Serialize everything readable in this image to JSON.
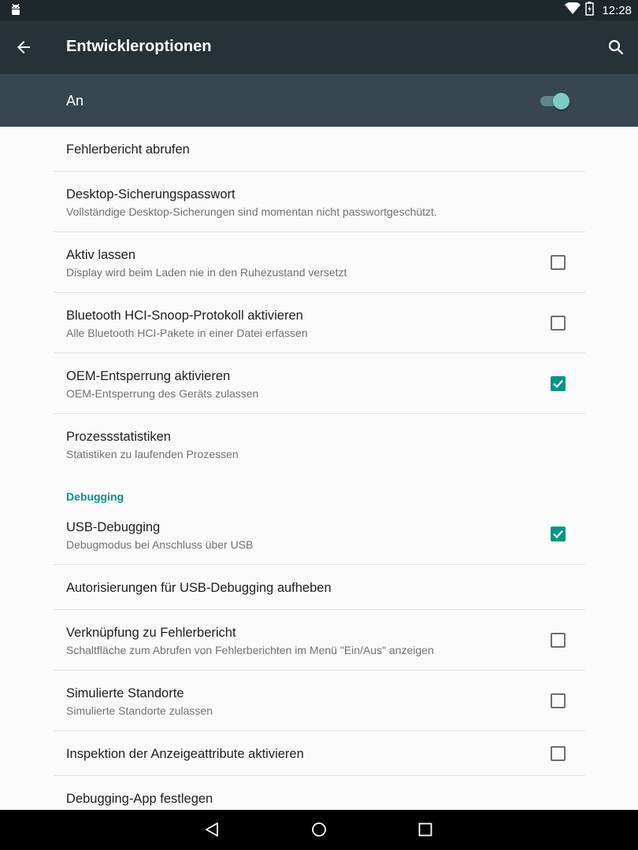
{
  "status_bar": {
    "time": "12:28",
    "icons": [
      "android-icon",
      "wifi-icon",
      "battery-icon"
    ]
  },
  "toolbar": {
    "title": "Entwickleroptionen",
    "back_icon": "arrow-back-icon",
    "search_icon": "search-icon"
  },
  "master_switch": {
    "label": "An",
    "checked": true
  },
  "items": [
    {
      "title": "Fehlerbericht abrufen",
      "summary": "",
      "checkbox": null
    },
    {
      "title": "Desktop-Sicherungspasswort",
      "summary": "Vollständige Desktop-Sicherungen sind momentan nicht passwortgeschützt.",
      "checkbox": null
    },
    {
      "title": "Aktiv lassen",
      "summary": "Display wird beim Laden nie in den Ruhezustand versetzt",
      "checkbox": false
    },
    {
      "title": "Bluetooth HCI-Snoop-Protokoll aktivieren",
      "summary": "Alle Bluetooth HCI-Pakete in einer Datei erfassen",
      "checkbox": false
    },
    {
      "title": "OEM-Entsperrung aktivieren",
      "summary": "OEM-Entsperrung des Geräts zulassen",
      "checkbox": true
    },
    {
      "title": "Prozessstatistiken",
      "summary": "Statistiken zu laufenden Prozessen",
      "checkbox": null
    }
  ],
  "debugging": {
    "category": "Debugging",
    "items": [
      {
        "title": "USB-Debugging",
        "summary": "Debugmodus bei Anschluss über USB",
        "checkbox": true
      },
      {
        "title": "Autorisierungen für USB-Debugging aufheben",
        "summary": "",
        "checkbox": null
      },
      {
        "title": "Verknüpfung zu Fehlerbericht",
        "summary": "Schaltfläche zum Abrufen von Fehlerberichten im Menü \"Ein/Aus\" anzeigen",
        "checkbox": false
      },
      {
        "title": "Simulierte Standorte",
        "summary": "Simulierte Standorte zulassen",
        "checkbox": false
      },
      {
        "title": "Inspektion der Anzeigeattribute aktivieren",
        "summary": "",
        "checkbox": false
      },
      {
        "title": "Debugging-App festlegen",
        "summary": "",
        "checkbox": null
      }
    ]
  },
  "colors": {
    "accent": "#009688",
    "toolbar": "#263238",
    "switch_bar": "#37474f"
  },
  "navigation_bar": [
    "back-nav-icon",
    "home-nav-icon",
    "recents-nav-icon"
  ]
}
